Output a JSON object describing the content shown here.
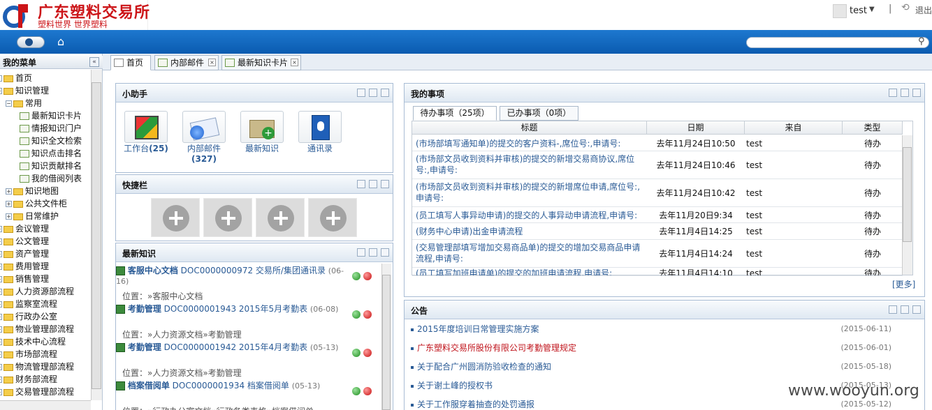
{
  "brand": {
    "title": "广东塑料交易所",
    "slogan": "塑料世界 世界塑料"
  },
  "user": {
    "name": "test",
    "logout": "退出"
  },
  "menu": {
    "title": "我的菜单",
    "items": [
      {
        "label": "首页"
      },
      {
        "label": "知识管理"
      },
      {
        "label": "常用"
      },
      {
        "label": "最新知识卡片"
      },
      {
        "label": "情报知识门户"
      },
      {
        "label": "知识全文检索"
      },
      {
        "label": "知识点击排名"
      },
      {
        "label": "知识贡献排名"
      },
      {
        "label": "我的借阅列表"
      },
      {
        "label": "知识地图"
      },
      {
        "label": "公共文件柜"
      },
      {
        "label": "日常维护"
      },
      {
        "label": "会议管理"
      },
      {
        "label": "公文管理"
      },
      {
        "label": "资产管理"
      },
      {
        "label": "费用管理"
      },
      {
        "label": "销售管理"
      },
      {
        "label": "人力资源部流程"
      },
      {
        "label": "监察室流程"
      },
      {
        "label": "行政办公室"
      },
      {
        "label": "物业管理部流程"
      },
      {
        "label": "技术中心流程"
      },
      {
        "label": "市场部流程"
      },
      {
        "label": "物流管理部流程"
      },
      {
        "label": "财务部流程"
      },
      {
        "label": "交易管理部流程"
      }
    ]
  },
  "tabs": [
    {
      "label": "首页"
    },
    {
      "label": "内部邮件"
    },
    {
      "label": "最新知识卡片"
    }
  ],
  "helper": {
    "title": "小助手",
    "items": [
      {
        "label": "工作台",
        "count": "(25)",
        "icon": "workbench-icon"
      },
      {
        "label": "内部邮件",
        "count": "(327)",
        "icon": "mail-icon"
      },
      {
        "label": "最新知识",
        "count": "",
        "icon": "new-knowledge-icon"
      },
      {
        "label": "通讯录",
        "count": "",
        "icon": "address-book-icon"
      }
    ]
  },
  "shortcut": {
    "title": "快捷栏"
  },
  "knowledge": {
    "title": "最新知识",
    "items": [
      {
        "title": "客服中心文档",
        "doc": "DOC0000000972 交易所/集团通讯录",
        "date": "(06-16)",
        "loc": "位置：»客服中心文档"
      },
      {
        "title": "考勤管理",
        "doc": "DOC0000001943 2015年5月考勤表",
        "date": "(06-08)",
        "loc": "位置：»人力资源文档»考勤管理"
      },
      {
        "title": "考勤管理",
        "doc": "DOC0000001942 2015年4月考勤表",
        "date": "(05-13)",
        "loc": "位置：»人力资源文档»考勤管理"
      },
      {
        "title": "档案借阅单",
        "doc": "DOC0000001934 档案借阅单",
        "date": "(05-13)",
        "loc": "位置：»行政办公室文档»行政各类表格»档案借阅单"
      }
    ]
  },
  "todo": {
    "title": "我的事项",
    "tab_pending": "待办事项（25项）",
    "tab_done": "已办事项（0项）",
    "columns": [
      "标题",
      "日期",
      "来自",
      "类型"
    ],
    "rows": [
      {
        "title": "(市场部填写通知单)的提交的客户资料-,席位号:,申请号:",
        "date": "去年11月24日10:50",
        "from": "test",
        "type": "待办"
      },
      {
        "title": "(市场部文员收到资料并审核)的提交的新增交易商协议,席位号:,申请号:",
        "date": "去年11月24日10:46",
        "from": "test",
        "type": "待办"
      },
      {
        "title": "(市场部文员收到资料并审核)的提交的新增席位申请,席位号:,申请号:",
        "date": "去年11月24日10:42",
        "from": "test",
        "type": "待办"
      },
      {
        "title": "(员工填写人事异动申请)的提交的人事异动申请流程,申请号:",
        "date": "去年11月20日9:34",
        "from": "test",
        "type": "待办"
      },
      {
        "title": "(财务中心申请)出金申请流程",
        "date": "去年11月4日14:25",
        "from": "test",
        "type": "待办"
      },
      {
        "title": "(交易管理部填写增加交易商品单)的提交的增加交易商品申请流程,申请号:",
        "date": "去年11月4日14:24",
        "from": "test",
        "type": "待办"
      },
      {
        "title": "(员工填写加班申请单)的提交的加班申请流程,申请号:",
        "date": "去年11月4日14:10",
        "from": "test",
        "type": "待办"
      }
    ],
    "more": "[更多]"
  },
  "notice": {
    "title": "公告",
    "items": [
      {
        "title": "2015年度培训日常管理实施方案",
        "date": "(2015-06-11)",
        "color": "#2a5b96"
      },
      {
        "title": "广东塑料交易所股份有限公司考勤管理规定",
        "date": "(2015-06-01)",
        "color": "#c0141c"
      },
      {
        "title": "关于配合广州圆消防验收检查的通知",
        "date": "(2015-05-18)",
        "color": "#2a5b96"
      },
      {
        "title": "关于谢土峰的授权书",
        "date": "(2015-05-13)",
        "color": "#2a5b96"
      },
      {
        "title": "关于工作服穿着抽查的处罚通报",
        "date": "(2015-05-12)",
        "color": "#2a5b96"
      }
    ]
  },
  "watermark": "www.wooyun.org"
}
